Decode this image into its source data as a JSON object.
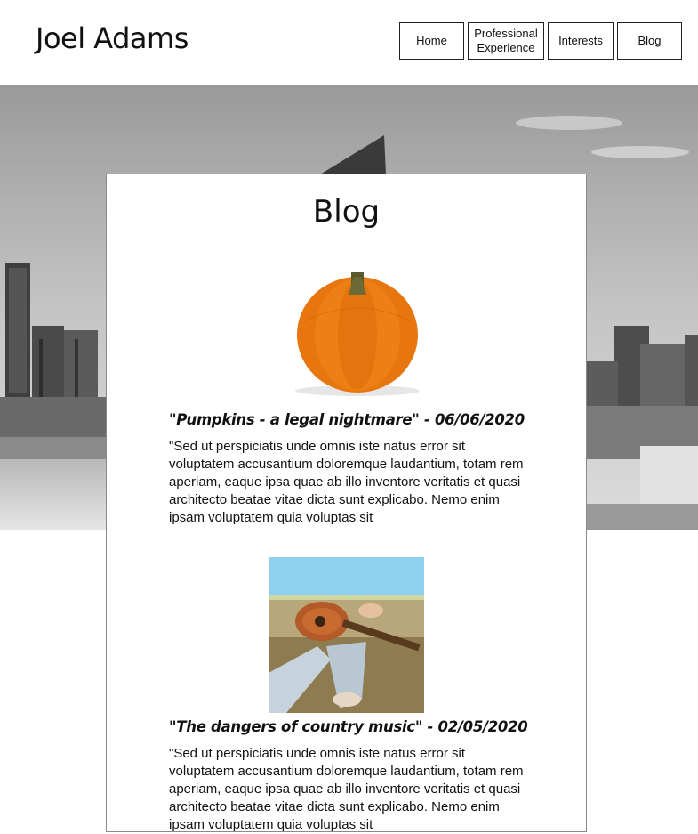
{
  "header": {
    "title": "Joel Adams",
    "nav": [
      {
        "label": "Home"
      },
      {
        "label": "Professional Experience",
        "lines": [
          "Professional",
          "Experience"
        ]
      },
      {
        "label": "Interests"
      },
      {
        "label": "Blog"
      }
    ]
  },
  "blog": {
    "title": "Blog",
    "posts": [
      {
        "title": "\"Pumpkins - a legal nightmare\"",
        "date": "06/06/2020",
        "heading": "\"Pumpkins - a legal nightmare\" - 06/06/2020",
        "image_icon": "pumpkin-image",
        "excerpt": "\"Sed ut perspiciatis unde omnis iste natus error sit voluptatem accusantium doloremque laudantium, totam rem aperiam, eaque ipsa quae ab illo inventore veritatis et quasi architecto beatae vitae dicta sunt explicabo. Nemo enim ipsam voluptatem quia voluptas sit"
      },
      {
        "title": "\"The dangers of country music\"",
        "date": "02/05/2020",
        "heading": "\"The dangers of country music\" - 02/05/2020",
        "image_icon": "guitar-image",
        "excerpt": "\"Sed ut perspiciatis unde omnis iste natus error sit voluptatem accusantium doloremque laudantium, totam rem aperiam, eaque ipsa quae ab illo inventore veritatis et quasi architecto beatae vitae dicta sunt explicabo. Nemo enim ipsam voluptatem quia voluptas sit"
      }
    ]
  },
  "colors": {
    "pumpkin": "#e8760f",
    "sky": "#8fd0ee",
    "border": "#8a8a8a"
  }
}
